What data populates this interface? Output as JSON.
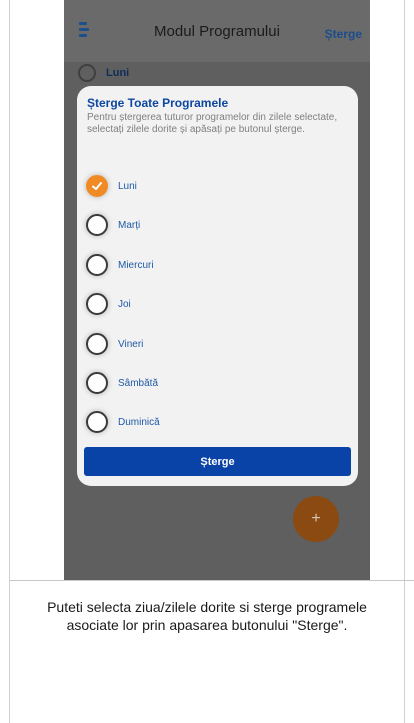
{
  "topbar": {
    "title": "Modul Programului",
    "action_label": "Șterge"
  },
  "background_row": {
    "label": "Luni"
  },
  "dialog": {
    "title": "Șterge Toate Programele",
    "description": "Pentru ștergerea tuturor programelor din zilele selectate, selectați zilele dorite și apăsați pe butonul șterge.",
    "options": [
      {
        "label": "Luni",
        "checked": true
      },
      {
        "label": "Marți",
        "checked": false
      },
      {
        "label": "Miercuri",
        "checked": false
      },
      {
        "label": "Joi",
        "checked": false
      },
      {
        "label": "Vineri",
        "checked": false
      },
      {
        "label": "Sâmbătă",
        "checked": false
      },
      {
        "label": "Duminică",
        "checked": false
      }
    ],
    "button_label": "Șterge"
  },
  "fab": {
    "icon": "plus-icon",
    "label": "+"
  },
  "caption": "Puteti selecta ziua/zilele dorite si sterge programele asociate lor prin apasarea butonului \"Sterge\".",
  "colors": {
    "accent": "#f08a24",
    "primary": "#0a43a8",
    "title_blue": "#0d47a1",
    "overlay": "#5f5f5f"
  }
}
